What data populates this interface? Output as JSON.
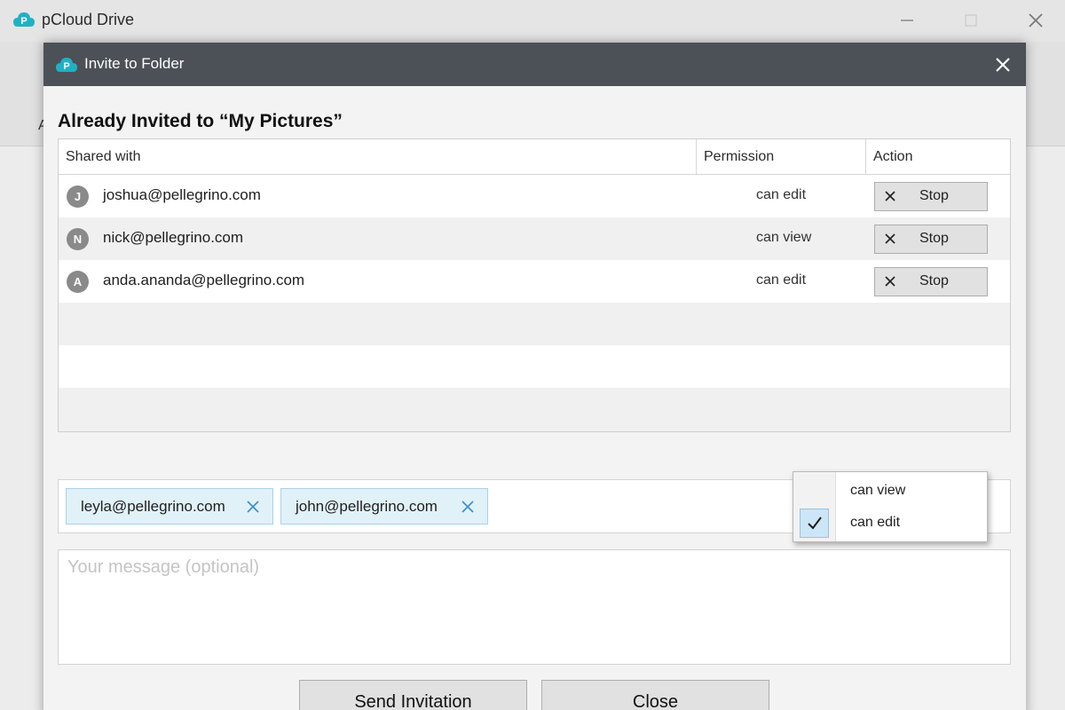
{
  "app": {
    "title": "pCloud Drive",
    "peek_text": "A"
  },
  "dialog": {
    "title": "Invite to Folder",
    "heading": "Already Invited to “My Pictures”"
  },
  "table": {
    "columns": [
      "Shared with",
      "Permission",
      "Action"
    ],
    "rows": [
      {
        "initial": "J",
        "email": "joshua@pellegrino.com",
        "permission": "can edit",
        "action": "Stop"
      },
      {
        "initial": "N",
        "email": "nick@pellegrino.com",
        "permission": "can view",
        "action": "Stop"
      },
      {
        "initial": "A",
        "email": "anda.ananda@pellegrino.com",
        "permission": "can edit",
        "action": "Stop"
      }
    ]
  },
  "recipients": {
    "chips": [
      "leyla@pellegrino.com",
      "john@pellegrino.com"
    ]
  },
  "permission_menu": {
    "options": [
      "can view",
      "can edit"
    ],
    "selected": "can edit"
  },
  "message": {
    "placeholder": "Your message (optional)",
    "value": ""
  },
  "buttons": {
    "send": "Send Invitation",
    "close": "Close"
  },
  "colors": {
    "header_bg": "#4b5157",
    "brand_teal": "#20b0c6",
    "chip_bg": "#e1f1f8",
    "chip_border": "#a8d2e7",
    "chip_x": "#3d8fc9"
  },
  "icons": {
    "logo": "pcloud-logo-icon",
    "close": "close-icon",
    "stop": "x-icon",
    "remove": "remove-icon",
    "check": "check-icon"
  }
}
